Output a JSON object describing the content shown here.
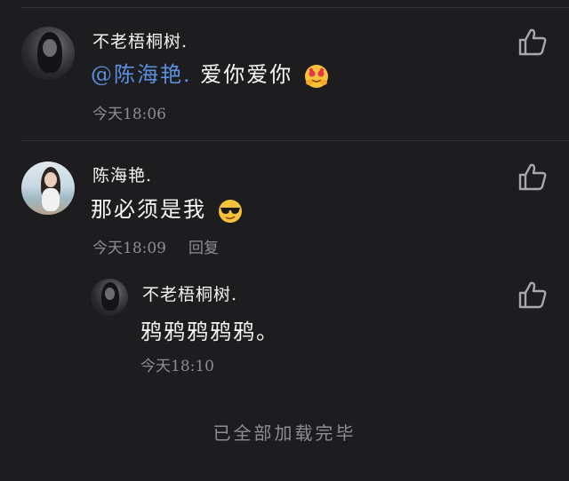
{
  "comments": [
    {
      "author": "不老梧桐树.",
      "mention": "@陈海艳.",
      "text": "爱你爱你",
      "emoji_icon": "hugging-face-emoji",
      "time": "今天18:06"
    },
    {
      "author": "陈海艳.",
      "text": "那必须是我",
      "emoji_icon": "sunglasses-face-emoji",
      "time": "今天18:09",
      "reply_label": "回复",
      "replies": [
        {
          "author": "不老梧桐树.",
          "text": "鸦鸦鸦鸦鸦。",
          "time": "今天18:10"
        }
      ]
    }
  ],
  "footer": {
    "loaded_text": "已全部加载完毕"
  },
  "icons": {
    "like": "thumbs-up-icon"
  },
  "colors": {
    "background": "#1d1d1f",
    "mention": "#5b8fe0",
    "meta": "#8d8d92",
    "text": "#f2f2f2"
  }
}
